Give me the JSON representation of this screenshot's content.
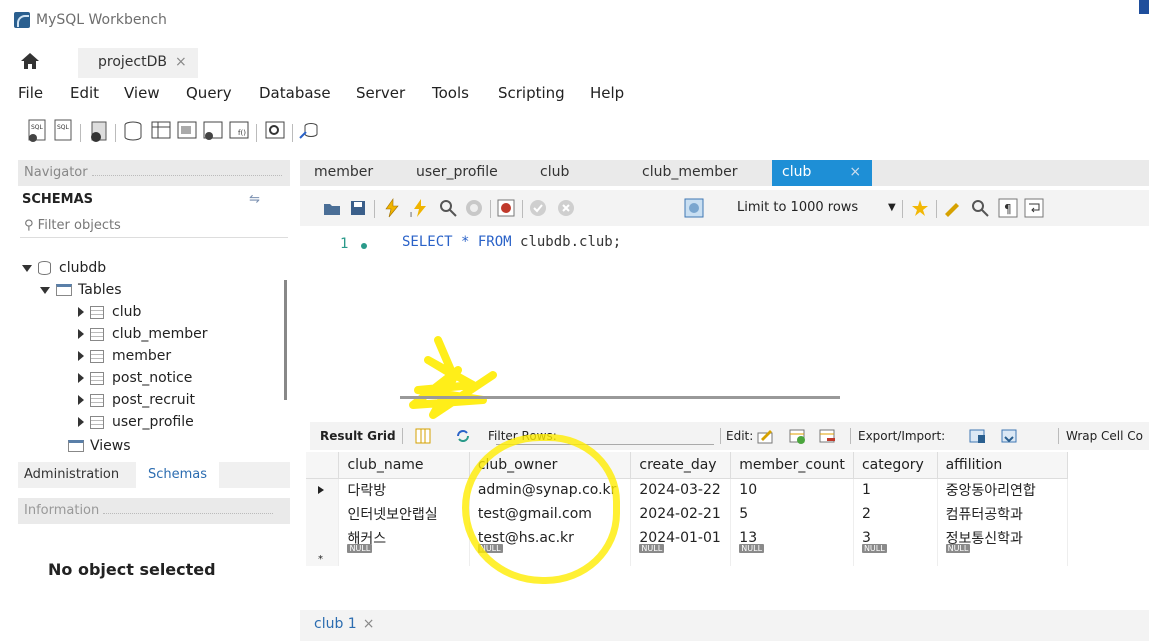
{
  "window": {
    "title": "MySQL Workbench"
  },
  "file_tabs": [
    {
      "label": "projectDB",
      "close": "×"
    }
  ],
  "menu": [
    "File",
    "Edit",
    "View",
    "Query",
    "Database",
    "Server",
    "Tools",
    "Scripting",
    "Help"
  ],
  "navigator": {
    "header": "Navigator",
    "schemas_label": "SCHEMAS",
    "filter_placeholder": "Filter objects",
    "schema": "clubdb",
    "tables_label": "Tables",
    "tables": [
      "club",
      "club_member",
      "member",
      "post_notice",
      "post_recruit",
      "user_profile"
    ],
    "views_label": "Views",
    "bottom_tabs": [
      "Administration",
      "Schemas"
    ],
    "info_header": "Information",
    "no_object": "No object selected"
  },
  "editor_tabs": [
    "member",
    "user_profile",
    "club",
    "club_member",
    "club"
  ],
  "active_tab_close": "×",
  "editor_toolbar": {
    "limit_label": "Limit to 1000 rows"
  },
  "sql": {
    "line": "1",
    "keyword": "SELECT * FROM ",
    "object": "clubdb.club;"
  },
  "result_toolbar": {
    "result_grid": "Result Grid",
    "filter_rows": "Filter Rows:",
    "edit": "Edit:",
    "export_import": "Export/Import:",
    "wrap": "Wrap Cell Co"
  },
  "grid": {
    "columns": [
      "club_name",
      "club_owner",
      "create_day",
      "member_count",
      "category",
      "affilition"
    ],
    "rows": [
      [
        "다락방",
        "admin@synap.co.kr",
        "2024-03-22",
        "10",
        "1",
        "중앙동아리연합"
      ],
      [
        "인터넷보안랩실",
        "test@gmail.com",
        "2024-02-21",
        "5",
        "2",
        "컴퓨터공학과"
      ],
      [
        "해커스",
        "test@hs.ac.kr",
        "2024-01-01",
        "13",
        "3",
        "정보통신학과"
      ]
    ],
    "null_label": "NULL",
    "new_row_marker": "*"
  },
  "result_tab": {
    "label": "club 1",
    "close": "×"
  },
  "colors": {
    "accent": "#1e8fd6",
    "highlight": "#ffec00",
    "link": "#2b6cb0"
  }
}
